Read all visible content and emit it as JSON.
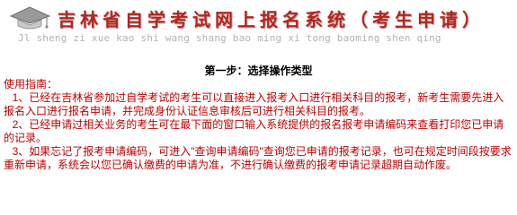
{
  "header": {
    "site_title": "吉林省自学考试网上报名系统（考生申请）",
    "site_pinyin": "Jl sheng zi xue kao shi wang shang bao ming xi tong baoming shen qing",
    "brand_color": "#b3261e",
    "logo_icon": "mortarboard-icon"
  },
  "main": {
    "step_title": "第一步：选择操作类型",
    "guide_heading": "使用指南：",
    "guide_items": [
      "1、已经在吉林省参加过自学考试的考生可以直接进入报考入口进行相关科目的报考，新考生需要先进入报名入口进行报名申请，并完成身份认证信息审核后可进行相关科目的报考。",
      "2、已经申请过相关业务的考生可在最下面的窗口输入系统提供的报名报考申请编码来查看打印您已申请的记录。",
      "3、如果忘记了报考申请编码，可进入\"查询申请编码\"查询您已申请的报考记录，也可在规定时间段按要求重新申请，系统会以您已确认缴费的申请为准，不进行确认缴费的报考申请记录超期自动作废。"
    ],
    "text_color": "#c00000"
  }
}
